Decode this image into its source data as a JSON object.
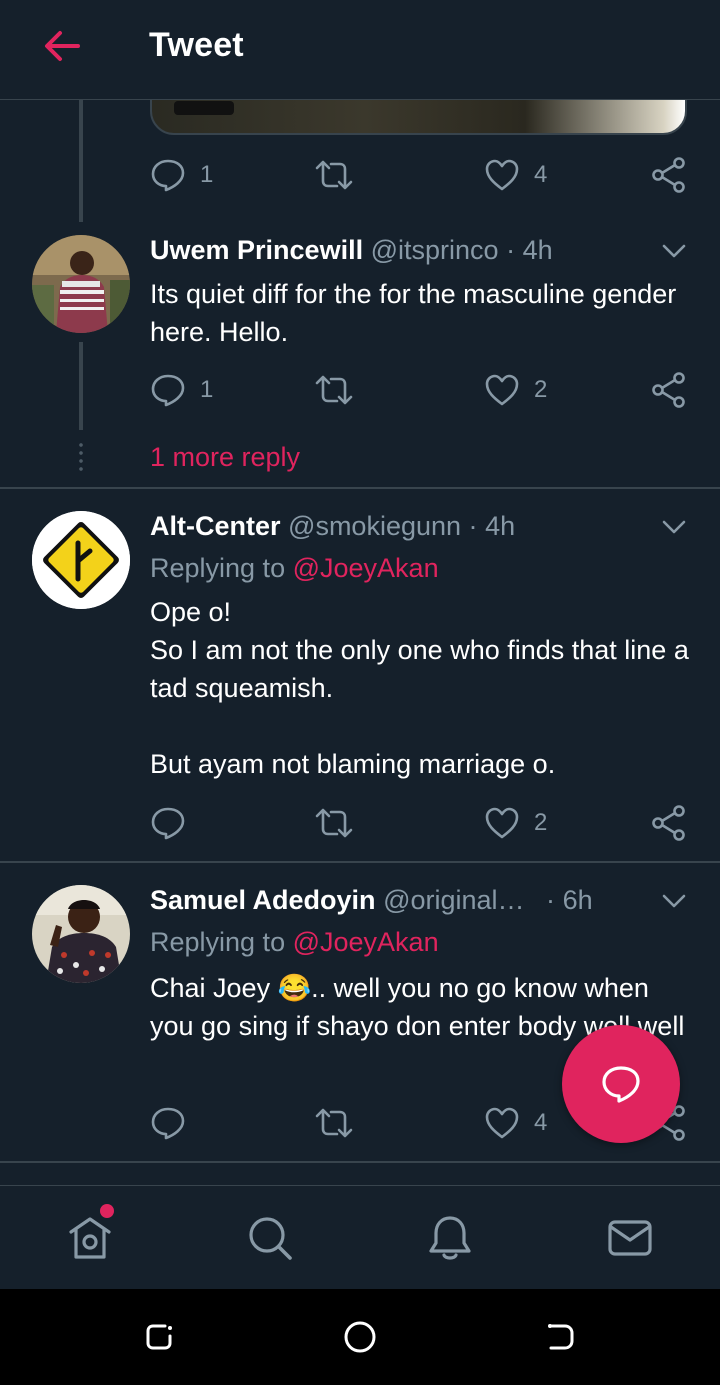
{
  "header": {
    "title": "Tweet"
  },
  "top_tweet_actions": {
    "replies": "1",
    "likes": "4"
  },
  "tweets": [
    {
      "name": "Uwem Princewill",
      "handle": "@itsprinco",
      "separator": "·",
      "time": "4h",
      "text": "Its quiet diff for the for the masculine gender here. Hello.",
      "replies": "1",
      "likes": "2",
      "more_replies": "1 more reply"
    },
    {
      "name": "Alt-Center",
      "handle": "@smokiegunn",
      "separator": "·",
      "time": "4h",
      "replying_prefix": "Replying to",
      "replying_to": "@JoeyAkan",
      "text": "Ope o!\nSo I am not the only one who finds that line a tad squeamish.\n\nBut ayam not blaming marriage o.",
      "likes": "2"
    },
    {
      "name": "Samuel Adedoyin",
      "handle": "@original…",
      "separator": "·",
      "time": "6h",
      "replying_prefix": "Replying to",
      "replying_to": "@JoeyAkan",
      "text": "Chai Joey 😂.. well you no go know when you go sing if shayo don enter body well well",
      "likes": "4"
    }
  ],
  "colors": {
    "background": "#15202b",
    "accent": "#e0245e",
    "muted": "#8899a6",
    "divider": "#38444d"
  },
  "icons": {
    "back": "arrow-left-icon",
    "reply": "speech-bubble-icon",
    "retweet": "retweet-icon",
    "like": "heart-icon",
    "share": "share-icon",
    "caret": "chevron-down-icon",
    "home": "home-icon",
    "search": "search-icon",
    "notifications": "bell-icon",
    "messages": "envelope-icon",
    "compose": "compose-reply-icon"
  }
}
